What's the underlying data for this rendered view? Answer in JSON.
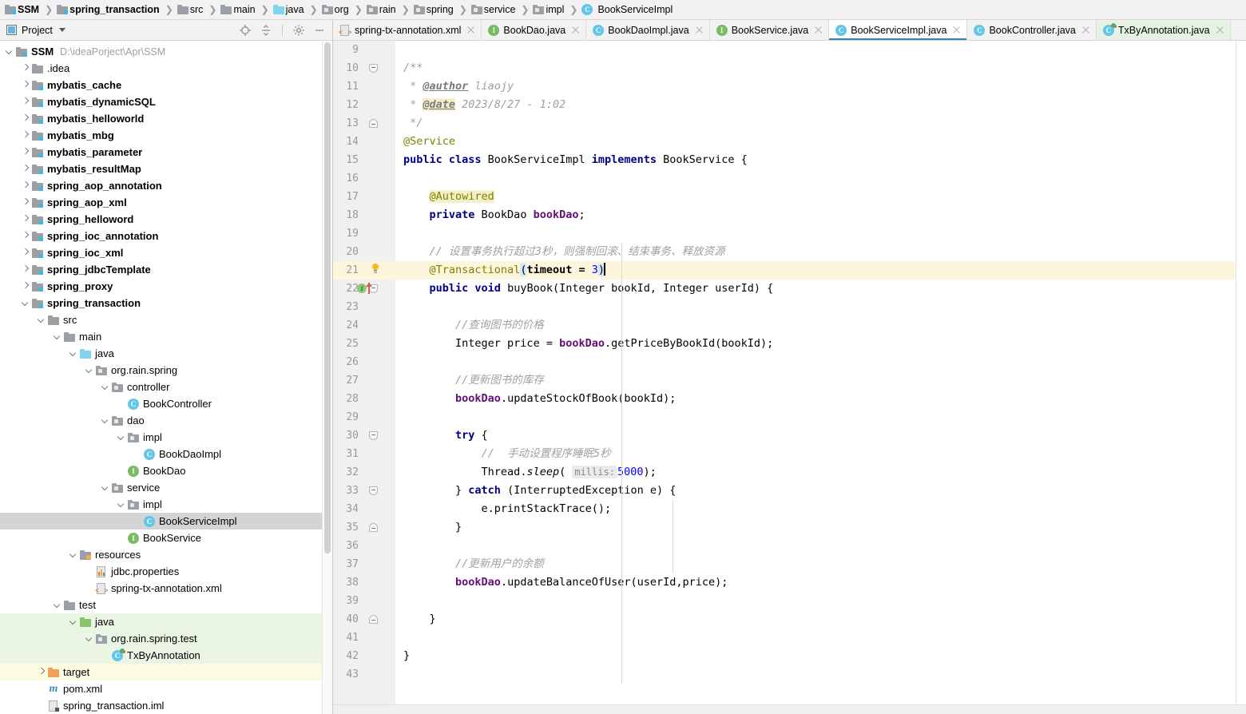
{
  "navbar": {
    "crumbs": [
      {
        "label": "SSM",
        "icon": "module-folder-icon",
        "bold": true
      },
      {
        "label": "spring_transaction",
        "icon": "module-folder-icon",
        "bold": true
      },
      {
        "label": "src",
        "icon": "folder-icon",
        "bold": false
      },
      {
        "label": "main",
        "icon": "folder-icon",
        "bold": false
      },
      {
        "label": "java",
        "icon": "source-folder-icon",
        "bold": false
      },
      {
        "label": "org",
        "icon": "package-icon",
        "bold": false
      },
      {
        "label": "rain",
        "icon": "package-icon",
        "bold": false
      },
      {
        "label": "spring",
        "icon": "package-icon",
        "bold": false
      },
      {
        "label": "service",
        "icon": "package-icon",
        "bold": false
      },
      {
        "label": "impl",
        "icon": "package-icon",
        "bold": false
      },
      {
        "label": "BookServiceImpl",
        "icon": "class-icon",
        "bold": false
      }
    ]
  },
  "sidebar": {
    "title": "Project",
    "actions": [
      {
        "name": "locate-target-icon"
      },
      {
        "name": "collapse-all-icon"
      },
      {
        "name": "gear-icon"
      },
      {
        "name": "minimize-icon"
      }
    ],
    "tree": [
      {
        "label": "SSM",
        "path": "D:\\ideaPorject\\Apr\\SSM",
        "icon": "module-folder-icon",
        "indent": 0,
        "twisty": "down",
        "bold": true
      },
      {
        "label": ".idea",
        "icon": "folder-icon",
        "indent": 1,
        "twisty": "right",
        "bold": false
      },
      {
        "label": "mybatis_cache",
        "icon": "module-folder-icon",
        "indent": 1,
        "twisty": "right",
        "bold": true
      },
      {
        "label": "mybatis_dynamicSQL",
        "icon": "module-folder-icon",
        "indent": 1,
        "twisty": "right",
        "bold": true
      },
      {
        "label": "mybatis_helloworld",
        "icon": "module-folder-icon",
        "indent": 1,
        "twisty": "right",
        "bold": true
      },
      {
        "label": "mybatis_mbg",
        "icon": "module-folder-icon",
        "indent": 1,
        "twisty": "right",
        "bold": true
      },
      {
        "label": "mybatis_parameter",
        "icon": "module-folder-icon",
        "indent": 1,
        "twisty": "right",
        "bold": true
      },
      {
        "label": "mybatis_resultMap",
        "icon": "module-folder-icon",
        "indent": 1,
        "twisty": "right",
        "bold": true
      },
      {
        "label": "spring_aop_annotation",
        "icon": "module-folder-icon",
        "indent": 1,
        "twisty": "right",
        "bold": true
      },
      {
        "label": "spring_aop_xml",
        "icon": "module-folder-icon",
        "indent": 1,
        "twisty": "right",
        "bold": true
      },
      {
        "label": "spring_helloword",
        "icon": "module-folder-icon",
        "indent": 1,
        "twisty": "right",
        "bold": true
      },
      {
        "label": "spring_ioc_annotation",
        "icon": "module-folder-icon",
        "indent": 1,
        "twisty": "right",
        "bold": true
      },
      {
        "label": "spring_ioc_xml",
        "icon": "module-folder-icon",
        "indent": 1,
        "twisty": "right",
        "bold": true
      },
      {
        "label": "spring_jdbcTemplate",
        "icon": "module-folder-icon",
        "indent": 1,
        "twisty": "right",
        "bold": true
      },
      {
        "label": "spring_proxy",
        "icon": "module-folder-icon",
        "indent": 1,
        "twisty": "right",
        "bold": true
      },
      {
        "label": "spring_transaction",
        "icon": "module-folder-icon",
        "indent": 1,
        "twisty": "down",
        "bold": true
      },
      {
        "label": "src",
        "icon": "folder-icon",
        "indent": 2,
        "twisty": "down",
        "bold": false
      },
      {
        "label": "main",
        "icon": "folder-icon",
        "indent": 3,
        "twisty": "down",
        "bold": false
      },
      {
        "label": "java",
        "icon": "source-folder-icon",
        "indent": 4,
        "twisty": "down",
        "bold": false
      },
      {
        "label": "org.rain.spring",
        "icon": "package-icon",
        "indent": 5,
        "twisty": "down",
        "bold": false
      },
      {
        "label": "controller",
        "icon": "package-icon",
        "indent": 6,
        "twisty": "down",
        "bold": false
      },
      {
        "label": "BookController",
        "icon": "class-icon",
        "indent": 7,
        "twisty": "none",
        "bold": false
      },
      {
        "label": "dao",
        "icon": "package-icon",
        "indent": 6,
        "twisty": "down",
        "bold": false
      },
      {
        "label": "impl",
        "icon": "package-icon",
        "indent": 7,
        "twisty": "down",
        "bold": false
      },
      {
        "label": "BookDaoImpl",
        "icon": "class-icon",
        "indent": 8,
        "twisty": "none",
        "bold": false
      },
      {
        "label": "BookDao",
        "icon": "interface-icon",
        "indent": 7,
        "twisty": "none",
        "bold": false
      },
      {
        "label": "service",
        "icon": "package-icon",
        "indent": 6,
        "twisty": "down",
        "bold": false
      },
      {
        "label": "impl",
        "icon": "package-icon",
        "indent": 7,
        "twisty": "down",
        "bold": false
      },
      {
        "label": "BookServiceImpl",
        "icon": "class-icon",
        "indent": 8,
        "twisty": "none",
        "bold": false,
        "selected": true
      },
      {
        "label": "BookService",
        "icon": "interface-icon",
        "indent": 7,
        "twisty": "none",
        "bold": false
      },
      {
        "label": "resources",
        "icon": "resources-folder-icon",
        "indent": 4,
        "twisty": "down",
        "bold": false
      },
      {
        "label": "jdbc.properties",
        "icon": "properties-icon",
        "indent": 5,
        "twisty": "none",
        "bold": false
      },
      {
        "label": "spring-tx-annotation.xml",
        "icon": "xml-icon",
        "indent": 5,
        "twisty": "none",
        "bold": false
      },
      {
        "label": "test",
        "icon": "folder-icon",
        "indent": 3,
        "twisty": "down",
        "bold": false
      },
      {
        "label": "java",
        "icon": "test-source-folder-icon",
        "indent": 4,
        "twisty": "down",
        "bold": false,
        "bg": "green"
      },
      {
        "label": "org.rain.spring.test",
        "icon": "package-icon",
        "indent": 5,
        "twisty": "down",
        "bold": false,
        "bg": "green"
      },
      {
        "label": "TxByAnnotation",
        "icon": "test-class-icon",
        "indent": 6,
        "twisty": "none",
        "bold": false,
        "bg": "green"
      },
      {
        "label": "target",
        "icon": "target-folder-icon",
        "indent": 2,
        "twisty": "right",
        "bold": false,
        "bg": "yellow"
      },
      {
        "label": "pom.xml",
        "icon": "maven-icon",
        "indent": 2,
        "twisty": "none",
        "bold": false
      },
      {
        "label": "spring_transaction.iml",
        "icon": "iml-icon",
        "indent": 2,
        "twisty": "none",
        "bold": false
      }
    ]
  },
  "tabs": [
    {
      "label": "spring-tx-annotation.xml",
      "icon": "xml-icon",
      "active": false,
      "test": false
    },
    {
      "label": "BookDao.java",
      "icon": "interface-icon",
      "active": false,
      "test": false
    },
    {
      "label": "BookDaoImpl.java",
      "icon": "class-icon",
      "active": false,
      "test": false
    },
    {
      "label": "BookService.java",
      "icon": "interface-icon",
      "active": false,
      "test": false
    },
    {
      "label": "BookServiceImpl.java",
      "icon": "class-icon",
      "active": true,
      "test": false
    },
    {
      "label": "BookController.java",
      "icon": "class-icon",
      "active": false,
      "test": false
    },
    {
      "label": "TxByAnnotation.java",
      "icon": "test-class-icon",
      "active": false,
      "test": true
    }
  ],
  "editor": {
    "first_line": 9,
    "last_line": 43,
    "current_line": 21,
    "line_numbers": [
      "9",
      "10",
      "11",
      "12",
      "13",
      "14",
      "15",
      "16",
      "17",
      "18",
      "19",
      "20",
      "21",
      "22",
      "23",
      "24",
      "25",
      "26",
      "27",
      "28",
      "29",
      "30",
      "31",
      "32",
      "33",
      "34",
      "35",
      "36",
      "37",
      "38",
      "39",
      "40",
      "41",
      "42",
      "43"
    ],
    "lines": {
      "l9": "",
      "l10": "/**",
      "l11_star": " * ",
      "l11_tag": "@author",
      "l11_rest": " liaojy",
      "l12_star": " * ",
      "l12_tag": "@date",
      "l12_rest": " 2023/8/27 - 1:02",
      "l13": " */",
      "l14": "@Service",
      "l15_kw1": "public class ",
      "l15_name": "BookServiceImpl ",
      "l15_kw2": "implements ",
      "l15_iface": "BookService {",
      "l17": "@Autowired",
      "l18_kw": "private ",
      "l18_type": "BookDao ",
      "l18_field": "bookDao",
      "l18_end": ";",
      "l20": "// 设置事务执行超过3秒，则强制回滚、结束事务、释放资源",
      "l21_ann": "@Transactional",
      "l21_open": "(",
      "l21_param": "timeout = ",
      "l21_num": "3",
      "l21_close": ")",
      "l22_kw": "public void ",
      "l22_rest": "buyBook(Integer bookId, Integer userId) {",
      "l24": "//查询图书的价格",
      "l25_a": "Integer price = ",
      "l25_fld": "bookDao",
      "l25_b": ".getPriceByBookId(bookId);",
      "l27": "//更新图书的库存",
      "l28_fld": "bookDao",
      "l28_b": ".updateStockOfBook(bookId);",
      "l30_kw": "try",
      "l30_b": " {",
      "l31": "//  手动设置程序睡眠5秒",
      "l32_a": "Thread.",
      "l32_m": "sleep",
      "l32_open": "( ",
      "l32_hint": "millis:",
      "l32_num": "5000",
      "l32_end": ");",
      "l33_a": "} ",
      "l33_kw": "catch",
      "l33_b": " (InterruptedException e) {",
      "l34": "e.printStackTrace();",
      "l35": "}",
      "l37": "//更新用户的余额",
      "l38_fld": "bookDao",
      "l38_b": ".updateBalanceOfUser(userId,price);",
      "l40": "}",
      "l42": "}"
    },
    "gutter_markers": {
      "line21": "intention-bulb-icon",
      "line22_implements": "implementing-method-icon"
    }
  },
  "colors": {
    "accent": "#3c7fb1",
    "current_line_bg": "#fdf6dd",
    "selection_bg": "#d4d4d4",
    "test_source_bg": "#eaf5e4",
    "target_bg": "#fdfae2",
    "annotation": "#808000",
    "keyword": "#000080",
    "field": "#660e7a",
    "number": "#0000ff",
    "comment": "#a0a0a0"
  }
}
